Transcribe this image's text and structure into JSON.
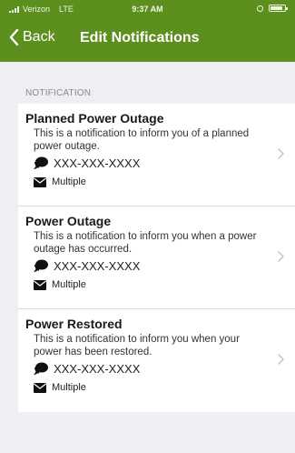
{
  "status_bar": {
    "carrier": "Verizon",
    "network": "LTE",
    "time": "9:37 AM"
  },
  "nav": {
    "back_label": "Back",
    "title": "Edit Notifications"
  },
  "section": {
    "label": "NOTIFICATION"
  },
  "notifications": [
    {
      "title": "Planned Power Outage",
      "description": "This is a notification to inform you of a planned power outage.",
      "phone": "XXX-XXX-XXXX",
      "email": "Multiple"
    },
    {
      "title": "Power Outage",
      "description": "This is a notification to inform you when a power outage has occurred.",
      "phone": "XXX-XXX-XXXX",
      "email": "Multiple"
    },
    {
      "title": "Power Restored",
      "description": "This is a notification to inform you when your power has been restored.",
      "phone": "XXX-XXX-XXXX",
      "email": "Multiple"
    }
  ],
  "colors": {
    "header_green": "#5d8f1f",
    "background": "#efeff3"
  },
  "icons": {
    "phone": "chat-phone-icon",
    "email": "envelope-icon",
    "row_arrow": "chevron-right-icon",
    "back": "chevron-left-icon"
  }
}
